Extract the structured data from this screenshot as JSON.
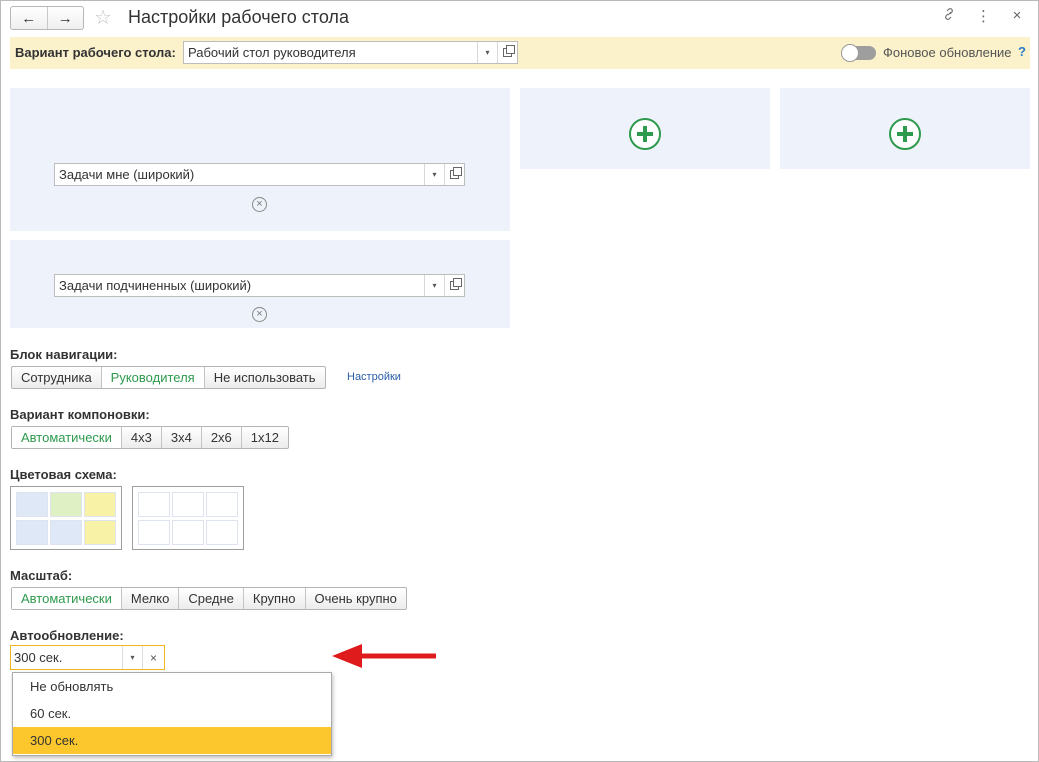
{
  "window": {
    "title": "Настройки рабочего стола",
    "back_icon": "←",
    "forward_icon": "→",
    "star_icon": "☆",
    "link_icon": "🔗",
    "more_icon": "⋮",
    "close_icon": "×"
  },
  "variant": {
    "label": "Вариант рабочего стола:",
    "value": "Рабочий стол руководителя",
    "background_update_label": "Фоновое обновление",
    "help": "?"
  },
  "widgets": [
    {
      "value": "Задачи мне (широкий)"
    },
    {
      "value": "Задачи подчиненных (широкий)"
    }
  ],
  "remove_icon": "×",
  "dropdown_icon": "▾",
  "navigation": {
    "label": "Блок навигации:",
    "options": [
      "Сотрудника",
      "Руководителя",
      "Не использовать"
    ],
    "selected": 1,
    "settings_link": "Настройки"
  },
  "layout": {
    "label": "Вариант компоновки:",
    "options": [
      "Автоматически",
      "4x3",
      "3x4",
      "2x6",
      "1x12"
    ],
    "selected": 0
  },
  "color_scheme": {
    "label": "Цветовая схема:",
    "colors": {
      "blue": "#dfe8f7",
      "green": "#dff1c4",
      "yellow": "#f7f2a6",
      "light": "#ffffff"
    }
  },
  "scale": {
    "label": "Масштаб:",
    "options": [
      "Автоматически",
      "Мелко",
      "Средне",
      "Крупно",
      "Очень крупно"
    ],
    "selected": 0
  },
  "autoupdate": {
    "label": "Автообновление:",
    "value": "300 сек.",
    "clear_icon": "×",
    "options": [
      "Не обновлять",
      "60 сек.",
      "300 сек."
    ],
    "selected": 2
  },
  "accent": {
    "green": "#2e9a4d",
    "yellow": "#fbc72c",
    "arrow": "#e01b1b"
  }
}
